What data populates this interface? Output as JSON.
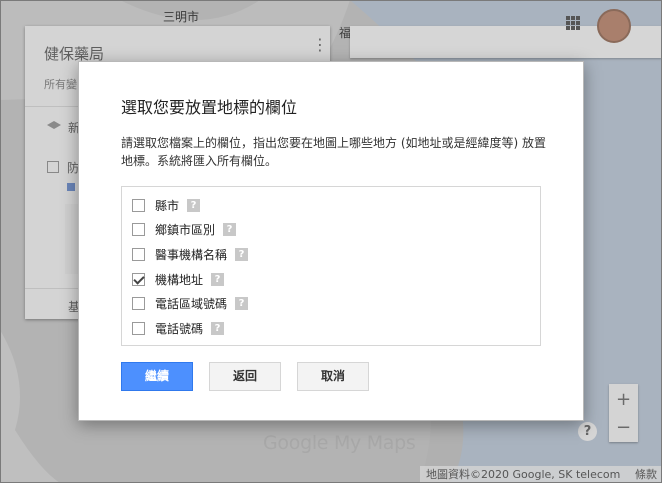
{
  "map": {
    "city_label": "三明市",
    "city_label_2": "福建",
    "logo": "Google My Maps",
    "footer_text": "地圖資料©2020 Google, SK telecom",
    "footer_terms": "條款",
    "zoom_in": "+",
    "zoom_out": "−",
    "help": "?"
  },
  "left_panel": {
    "title": "健保藥局",
    "subtitle": "所有變",
    "menu": "⋮",
    "layer_label": "新",
    "item_label": "防",
    "body_text": "緣\n通",
    "base_label": "基"
  },
  "dialog": {
    "title": "選取您要放置地標的欄位",
    "description": "請選取您檔案上的欄位，指出您要在地圖上哪些地方 (如地址或是經緯度等) 放置地標。系統將匯入所有欄位。",
    "fields": [
      {
        "label": "縣市",
        "checked": false
      },
      {
        "label": "鄉鎮市區別",
        "checked": false
      },
      {
        "label": "醫事機構名稱",
        "checked": false
      },
      {
        "label": "機構地址",
        "checked": true
      },
      {
        "label": "電話區域號碼",
        "checked": false
      },
      {
        "label": "電話號碼",
        "checked": false
      }
    ],
    "help_glyph": "?",
    "buttons": {
      "continue": "繼續",
      "back": "返回",
      "cancel": "取消"
    }
  }
}
